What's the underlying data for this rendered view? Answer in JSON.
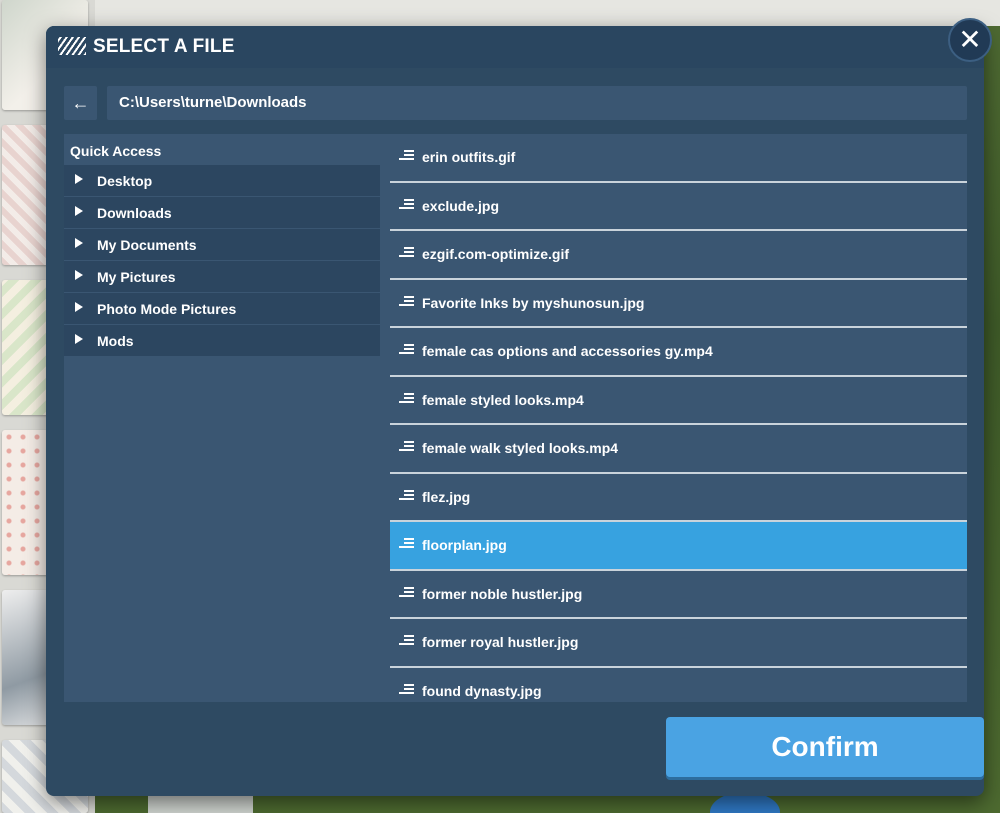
{
  "dialog": {
    "title": "SELECT A FILE",
    "path": "C:\\Users\\turne\\Downloads",
    "confirm_label": "Confirm"
  },
  "icons": {
    "title": "stripes-icon",
    "close": "close-icon",
    "back": "arrow-left-icon",
    "folder_expand": "triangle-right-icon",
    "file": "file-lines-icon"
  },
  "glyphs": {
    "close": "✕",
    "back": "←"
  },
  "quick_access": {
    "title": "Quick Access",
    "items": [
      {
        "label": "Desktop"
      },
      {
        "label": "Downloads"
      },
      {
        "label": "My Documents"
      },
      {
        "label": "My Pictures"
      },
      {
        "label": "Photo Mode Pictures"
      },
      {
        "label": "Mods"
      }
    ]
  },
  "files": [
    {
      "name": "erin outfits.gif"
    },
    {
      "name": "exclude.jpg"
    },
    {
      "name": "ezgif.com-optimize.gif"
    },
    {
      "name": "Favorite Inks by myshunosun.jpg"
    },
    {
      "name": "female cas options and accessories gy.mp4"
    },
    {
      "name": "female styled looks.mp4"
    },
    {
      "name": "female walk styled looks.mp4"
    },
    {
      "name": "flez.jpg"
    },
    {
      "name": "floorplan.jpg",
      "selected": true
    },
    {
      "name": "former noble hustler.jpg"
    },
    {
      "name": "former royal hustler.jpg"
    },
    {
      "name": "found dynasty.jpg"
    }
  ],
  "colors": {
    "dialog_bg": "#2e4a62",
    "panel_bg": "#3a5672",
    "selected_row": "#37a2e0",
    "confirm_button": "#4aa3e3"
  }
}
